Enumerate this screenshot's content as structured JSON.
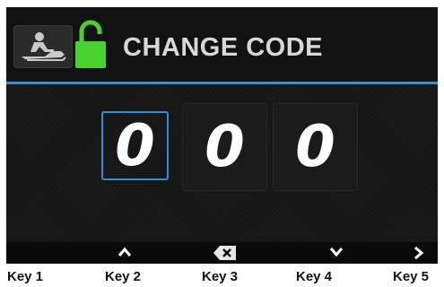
{
  "header": {
    "title": "CHANGE CODE"
  },
  "icons": {
    "mode": "snowmobile-icon",
    "lock": "unlocked-lock-icon",
    "lock_color": "#47d22c",
    "accent": "#2e8fd6"
  },
  "code_digits": [
    {
      "value": "0",
      "selected": true
    },
    {
      "value": "0",
      "selected": false
    },
    {
      "value": "0",
      "selected": false
    }
  ],
  "softkeys": [
    {
      "icon": "none",
      "label": "Key 1"
    },
    {
      "icon": "chevron-up-icon",
      "label": "Key 2"
    },
    {
      "icon": "backspace-icon",
      "label": "Key 3"
    },
    {
      "icon": "chevron-down-icon",
      "label": "Key 4"
    },
    {
      "icon": "chevron-right-icon",
      "label": "Key 5"
    }
  ]
}
